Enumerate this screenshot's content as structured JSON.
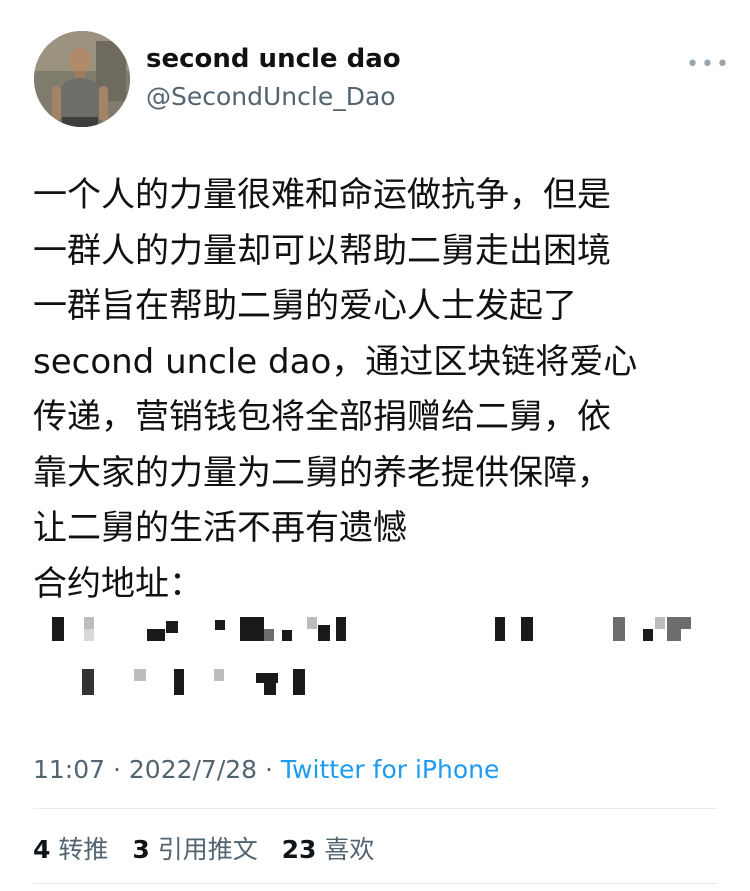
{
  "tweet": {
    "display_name": "second uncle dao",
    "handle": "@SecondUncle_Dao",
    "more_icon": "•••",
    "body_lines": [
      "一个人的力量很难和命运做抗争，但是",
      "一群人的力量却可以帮助二舅走出困境",
      "一群旨在帮助二舅的爱心人士发起了",
      "second uncle dao，通过区块链将爱心",
      "传递，营销钱包将全部捐赠给二舅，依",
      "靠大家的力量为二舅的养老提供保障，",
      "让二舅的生活不再有遗憾",
      "合约地址："
    ],
    "time": "11:07",
    "separator": " · ",
    "date": "2022/7/28",
    "source": "Twitter for iPhone"
  },
  "stats": {
    "retweets_count": "4",
    "retweets_label": "转推",
    "quotes_count": "3",
    "quotes_label": "引用推文",
    "likes_count": "23",
    "likes_label": "喜欢"
  },
  "colors": {
    "link": "#1d9bf0",
    "secondary_text": "#536471",
    "divider": "#e6ecf0"
  }
}
